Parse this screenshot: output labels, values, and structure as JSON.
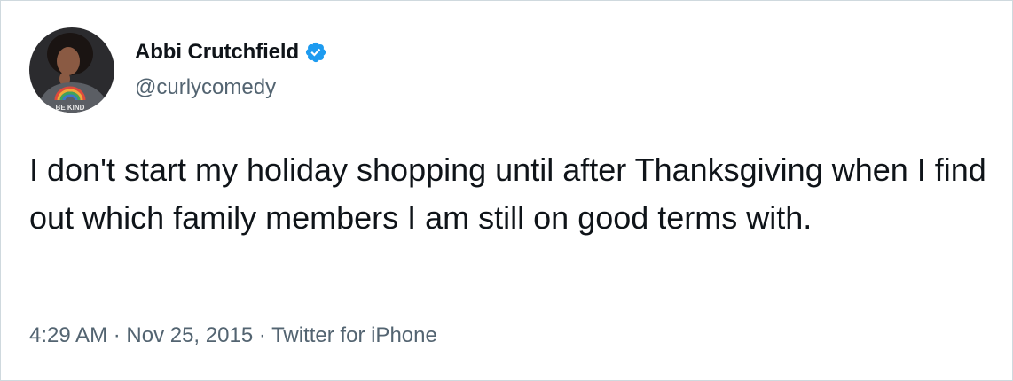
{
  "author": {
    "display_name": "Abbi Crutchfield",
    "handle": "@curlycomedy",
    "verified": true,
    "avatar_shirt_text": "BE KIND"
  },
  "tweet": {
    "text": "I don't start my holiday shopping until after Thanksgiving when I find out which family members I am still on good terms with.",
    "time": "4:29 AM",
    "date": "Nov 25, 2015",
    "source": "Twitter for iPhone",
    "separator": " · "
  },
  "colors": {
    "text_primary": "#0f1419",
    "text_secondary": "#536471",
    "verified_blue": "#1d9bf0",
    "border": "#cfd9de"
  }
}
